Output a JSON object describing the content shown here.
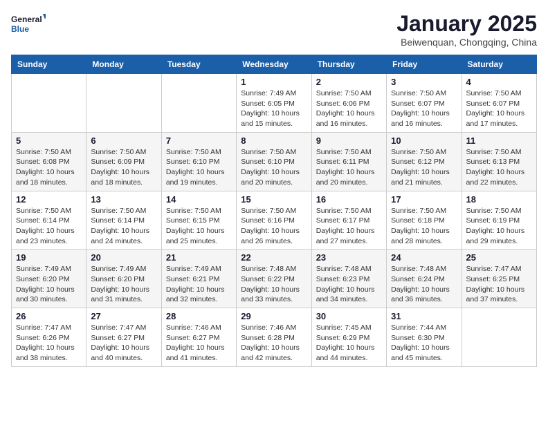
{
  "logo": {
    "text_general": "General",
    "text_blue": "Blue"
  },
  "title": "January 2025",
  "subtitle": "Beiwenquan, Chongqing, China",
  "days_of_week": [
    "Sunday",
    "Monday",
    "Tuesday",
    "Wednesday",
    "Thursday",
    "Friday",
    "Saturday"
  ],
  "weeks": [
    [
      {
        "day": "",
        "info": ""
      },
      {
        "day": "",
        "info": ""
      },
      {
        "day": "",
        "info": ""
      },
      {
        "day": "1",
        "info": "Sunrise: 7:49 AM\nSunset: 6:05 PM\nDaylight: 10 hours\nand 15 minutes."
      },
      {
        "day": "2",
        "info": "Sunrise: 7:50 AM\nSunset: 6:06 PM\nDaylight: 10 hours\nand 16 minutes."
      },
      {
        "day": "3",
        "info": "Sunrise: 7:50 AM\nSunset: 6:07 PM\nDaylight: 10 hours\nand 16 minutes."
      },
      {
        "day": "4",
        "info": "Sunrise: 7:50 AM\nSunset: 6:07 PM\nDaylight: 10 hours\nand 17 minutes."
      }
    ],
    [
      {
        "day": "5",
        "info": "Sunrise: 7:50 AM\nSunset: 6:08 PM\nDaylight: 10 hours\nand 18 minutes."
      },
      {
        "day": "6",
        "info": "Sunrise: 7:50 AM\nSunset: 6:09 PM\nDaylight: 10 hours\nand 18 minutes."
      },
      {
        "day": "7",
        "info": "Sunrise: 7:50 AM\nSunset: 6:10 PM\nDaylight: 10 hours\nand 19 minutes."
      },
      {
        "day": "8",
        "info": "Sunrise: 7:50 AM\nSunset: 6:10 PM\nDaylight: 10 hours\nand 20 minutes."
      },
      {
        "day": "9",
        "info": "Sunrise: 7:50 AM\nSunset: 6:11 PM\nDaylight: 10 hours\nand 20 minutes."
      },
      {
        "day": "10",
        "info": "Sunrise: 7:50 AM\nSunset: 6:12 PM\nDaylight: 10 hours\nand 21 minutes."
      },
      {
        "day": "11",
        "info": "Sunrise: 7:50 AM\nSunset: 6:13 PM\nDaylight: 10 hours\nand 22 minutes."
      }
    ],
    [
      {
        "day": "12",
        "info": "Sunrise: 7:50 AM\nSunset: 6:14 PM\nDaylight: 10 hours\nand 23 minutes."
      },
      {
        "day": "13",
        "info": "Sunrise: 7:50 AM\nSunset: 6:14 PM\nDaylight: 10 hours\nand 24 minutes."
      },
      {
        "day": "14",
        "info": "Sunrise: 7:50 AM\nSunset: 6:15 PM\nDaylight: 10 hours\nand 25 minutes."
      },
      {
        "day": "15",
        "info": "Sunrise: 7:50 AM\nSunset: 6:16 PM\nDaylight: 10 hours\nand 26 minutes."
      },
      {
        "day": "16",
        "info": "Sunrise: 7:50 AM\nSunset: 6:17 PM\nDaylight: 10 hours\nand 27 minutes."
      },
      {
        "day": "17",
        "info": "Sunrise: 7:50 AM\nSunset: 6:18 PM\nDaylight: 10 hours\nand 28 minutes."
      },
      {
        "day": "18",
        "info": "Sunrise: 7:50 AM\nSunset: 6:19 PM\nDaylight: 10 hours\nand 29 minutes."
      }
    ],
    [
      {
        "day": "19",
        "info": "Sunrise: 7:49 AM\nSunset: 6:20 PM\nDaylight: 10 hours\nand 30 minutes."
      },
      {
        "day": "20",
        "info": "Sunrise: 7:49 AM\nSunset: 6:20 PM\nDaylight: 10 hours\nand 31 minutes."
      },
      {
        "day": "21",
        "info": "Sunrise: 7:49 AM\nSunset: 6:21 PM\nDaylight: 10 hours\nand 32 minutes."
      },
      {
        "day": "22",
        "info": "Sunrise: 7:48 AM\nSunset: 6:22 PM\nDaylight: 10 hours\nand 33 minutes."
      },
      {
        "day": "23",
        "info": "Sunrise: 7:48 AM\nSunset: 6:23 PM\nDaylight: 10 hours\nand 34 minutes."
      },
      {
        "day": "24",
        "info": "Sunrise: 7:48 AM\nSunset: 6:24 PM\nDaylight: 10 hours\nand 36 minutes."
      },
      {
        "day": "25",
        "info": "Sunrise: 7:47 AM\nSunset: 6:25 PM\nDaylight: 10 hours\nand 37 minutes."
      }
    ],
    [
      {
        "day": "26",
        "info": "Sunrise: 7:47 AM\nSunset: 6:26 PM\nDaylight: 10 hours\nand 38 minutes."
      },
      {
        "day": "27",
        "info": "Sunrise: 7:47 AM\nSunset: 6:27 PM\nDaylight: 10 hours\nand 40 minutes."
      },
      {
        "day": "28",
        "info": "Sunrise: 7:46 AM\nSunset: 6:27 PM\nDaylight: 10 hours\nand 41 minutes."
      },
      {
        "day": "29",
        "info": "Sunrise: 7:46 AM\nSunset: 6:28 PM\nDaylight: 10 hours\nand 42 minutes."
      },
      {
        "day": "30",
        "info": "Sunrise: 7:45 AM\nSunset: 6:29 PM\nDaylight: 10 hours\nand 44 minutes."
      },
      {
        "day": "31",
        "info": "Sunrise: 7:44 AM\nSunset: 6:30 PM\nDaylight: 10 hours\nand 45 minutes."
      },
      {
        "day": "",
        "info": ""
      }
    ]
  ]
}
